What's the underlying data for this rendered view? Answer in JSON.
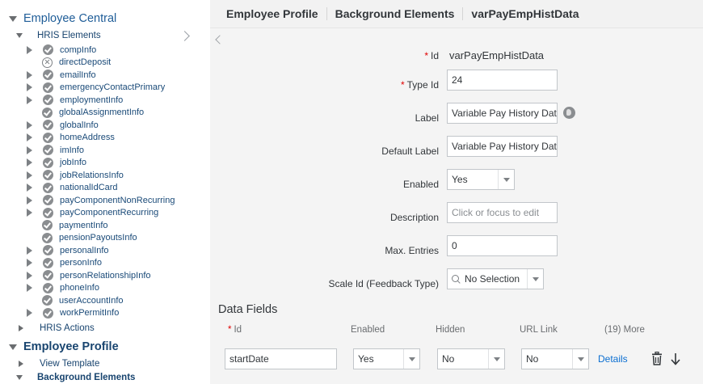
{
  "tree": {
    "section_title": "Employee Central",
    "hris_elements_label": "HRIS Elements",
    "items": [
      {
        "label": "compInfo",
        "expandable": true,
        "status": "ok"
      },
      {
        "label": "directDeposit",
        "expandable": false,
        "status": "error"
      },
      {
        "label": "emailInfo",
        "expandable": true,
        "status": "ok"
      },
      {
        "label": "emergencyContactPrimary",
        "expandable": true,
        "status": "ok"
      },
      {
        "label": "employmentInfo",
        "expandable": true,
        "status": "ok"
      },
      {
        "label": "globalAssignmentInfo",
        "expandable": false,
        "status": "ok"
      },
      {
        "label": "globalInfo",
        "expandable": true,
        "status": "ok"
      },
      {
        "label": "homeAddress",
        "expandable": true,
        "status": "ok"
      },
      {
        "label": "imInfo",
        "expandable": true,
        "status": "ok"
      },
      {
        "label": "jobInfo",
        "expandable": true,
        "status": "ok"
      },
      {
        "label": "jobRelationsInfo",
        "expandable": true,
        "status": "ok"
      },
      {
        "label": "nationalIdCard",
        "expandable": true,
        "status": "ok"
      },
      {
        "label": "payComponentNonRecurring",
        "expandable": true,
        "status": "ok"
      },
      {
        "label": "payComponentRecurring",
        "expandable": true,
        "status": "ok"
      },
      {
        "label": "paymentInfo",
        "expandable": false,
        "status": "ok"
      },
      {
        "label": "pensionPayoutsInfo",
        "expandable": false,
        "status": "ok"
      },
      {
        "label": "personalInfo",
        "expandable": true,
        "status": "ok"
      },
      {
        "label": "personInfo",
        "expandable": true,
        "status": "ok"
      },
      {
        "label": "personRelationshipInfo",
        "expandable": true,
        "status": "ok"
      },
      {
        "label": "phoneInfo",
        "expandable": true,
        "status": "ok"
      },
      {
        "label": "userAccountInfo",
        "expandable": false,
        "status": "ok"
      },
      {
        "label": "workPermitInfo",
        "expandable": true,
        "status": "ok"
      }
    ],
    "hris_actions_label": "HRIS Actions",
    "profile_title": "Employee Profile",
    "view_template_label": "View Template",
    "background_elements_label": "Background Elements"
  },
  "breadcrumb": [
    "Employee Profile",
    "Background Elements",
    "varPayEmpHistData"
  ],
  "form": {
    "id_label": "Id",
    "id_value": "varPayEmpHistData",
    "type_id_label": "Type Id",
    "type_id_value": "24",
    "label_label": "Label",
    "label_value": "Variable Pay History Data",
    "default_label_label": "Default Label",
    "default_label_value": "Variable Pay History Data",
    "enabled_label": "Enabled",
    "enabled_value": "Yes",
    "description_label": "Description",
    "description_placeholder": "Click or focus to edit",
    "max_entries_label": "Max. Entries",
    "max_entries_value": "0",
    "scale_id_label": "Scale Id (Feedback Type)",
    "scale_id_value": "No Selection",
    "required_marker": "*"
  },
  "data_fields": {
    "title": "Data Fields",
    "columns": {
      "id": "Id",
      "enabled": "Enabled",
      "hidden": "Hidden",
      "url_link": "URL Link",
      "more": "(19) More"
    },
    "row": {
      "id": "startDate",
      "enabled": "Yes",
      "hidden": "No",
      "url_link": "No",
      "details": "Details"
    }
  },
  "colors": {
    "accent": "#0a6ed1",
    "link": "#1a4a78",
    "required": "#e00000"
  }
}
